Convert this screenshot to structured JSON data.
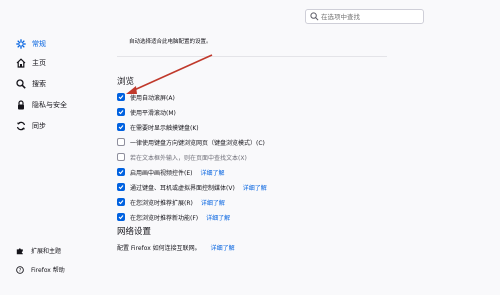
{
  "search": {
    "placeholder": "在选项中查找"
  },
  "sidebar": {
    "items": [
      {
        "label": "常规",
        "icon": "gear-icon",
        "active": true
      },
      {
        "label": "主页",
        "icon": "home-icon"
      },
      {
        "label": "搜索",
        "icon": "search-icon"
      },
      {
        "label": "隐私与安全",
        "icon": "lock-icon"
      },
      {
        "label": "同步",
        "icon": "sync-icon"
      }
    ],
    "bottom": [
      {
        "label": "扩展和主题",
        "icon": "puzzle-icon"
      },
      {
        "label": "Firefox 帮助",
        "icon": "help-icon"
      }
    ]
  },
  "main": {
    "top_note": "自动选择适合此电脑配置的设置。",
    "browse": {
      "title": "浏览",
      "items": [
        {
          "label": "使用自动滚屏(A)",
          "checked": true
        },
        {
          "label": "使用平滑滚动(M)",
          "checked": true
        },
        {
          "label": "在需要时显示触摸键盘(K)",
          "checked": true
        },
        {
          "label": "一律使用键盘方向键浏览网页（键盘浏览模式）(C)",
          "checked": false
        },
        {
          "label": "若在文本框外输入，则在页面中查找文本(X)",
          "checked": false,
          "disabled": true
        },
        {
          "label": "启用画中画视频控件(E)",
          "checked": true,
          "learn_more": "详细了解"
        },
        {
          "label": "通过键盘、耳机或虚拟界面控制媒体(V)",
          "checked": true,
          "learn_more": "详细了解"
        },
        {
          "label": "在您浏览时推荐扩展(R)",
          "checked": true,
          "learn_more": "详细了解"
        },
        {
          "label": "在您浏览时推荐新功能(F)",
          "checked": true,
          "learn_more": "详细了解"
        }
      ]
    },
    "network": {
      "title": "网络设置",
      "desc": "配置 Firefox 如何连接互联网。",
      "learn_more": "详细了解"
    }
  },
  "colors": {
    "accent": "#0061e0",
    "annotation_arrow": "#c0392b"
  }
}
